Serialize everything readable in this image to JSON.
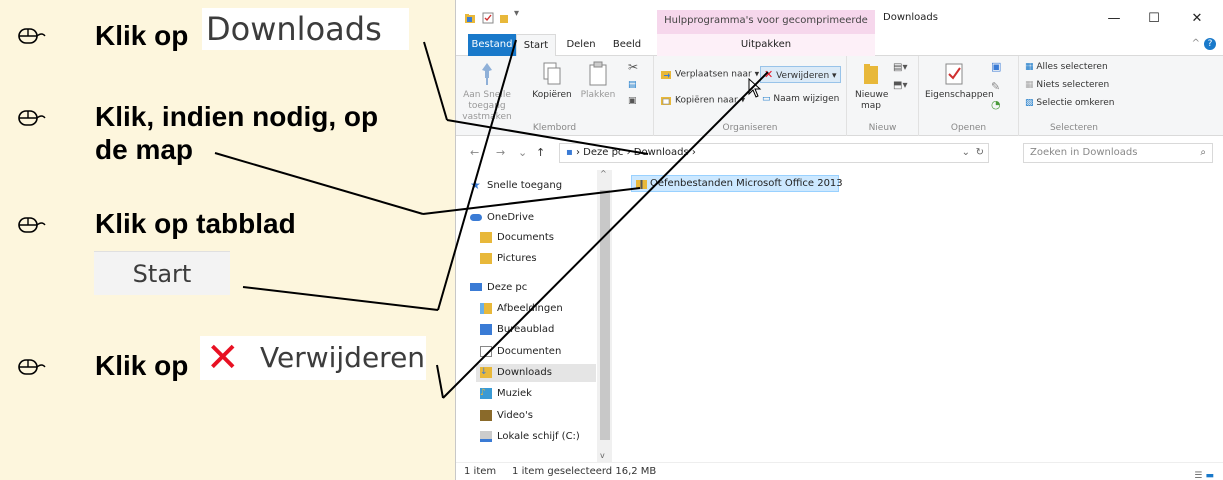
{
  "instructions": {
    "step1_text": "Klik op",
    "step1_word": "Downloads",
    "step2_line1": "Klik, indien nodig, op",
    "step2_line2": "de map",
    "step3_text": "Klik op tabblad",
    "step3_word": "Start",
    "step4_text": "Klik op",
    "step4_word": "Verwijderen"
  },
  "window": {
    "context_tab_group": "Hulpprogramma's voor gecomprimeerde mappen",
    "title": "Downloads",
    "minimize": "—",
    "maximize": "☐",
    "close": "✕"
  },
  "tabs": {
    "bestand": "Bestand",
    "start": "Start",
    "delen": "Delen",
    "beeld": "Beeld",
    "uitpakken": "Uitpakken"
  },
  "ribbon": {
    "klembord": {
      "label": "Klembord",
      "pin_line1": "Aan Snelle toegang",
      "pin_line2": "vastmaken",
      "copy": "Kopiëren",
      "paste": "Plakken"
    },
    "organiseren": {
      "label": "Organiseren",
      "move_to": "Verplaatsen naar",
      "copy_to": "Kopiëren naar",
      "delete": "Verwijderen",
      "rename": "Naam wijzigen"
    },
    "nieuw": {
      "label": "Nieuw",
      "new_folder_line1": "Nieuwe",
      "new_folder_line2": "map"
    },
    "openen": {
      "label": "Openen",
      "properties": "Eigenschappen"
    },
    "selecteren": {
      "label": "Selecteren",
      "select_all": "Alles selecteren",
      "select_none": "Niets selecteren",
      "invert": "Selectie omkeren"
    }
  },
  "address": {
    "path_1": "Deze pc",
    "path_2": "Downloads",
    "search_placeholder": "Zoeken in Downloads"
  },
  "nav": {
    "quick_access": "Snelle toegang",
    "onedrive": "OneDrive",
    "documents": "Documents",
    "pictures": "Pictures",
    "this_pc": "Deze pc",
    "afbeeldingen": "Afbeeldingen",
    "bureaublad": "Bureaublad",
    "documenten": "Documenten",
    "downloads": "Downloads",
    "muziek": "Muziek",
    "videos": "Video's",
    "lokale_schijf": "Lokale schijf (C:)"
  },
  "files": {
    "item1": "Oefenbestanden Microsoft Office 2013"
  },
  "status": {
    "count": "1 item",
    "selected": "1 item geselecteerd",
    "size": "16,2 MB"
  },
  "colors": {
    "accent_blue": "#1979ca",
    "delete_red": "#e81123",
    "folder_yellow": "#e8b83a",
    "panel_bg": "#fdf6dd"
  }
}
